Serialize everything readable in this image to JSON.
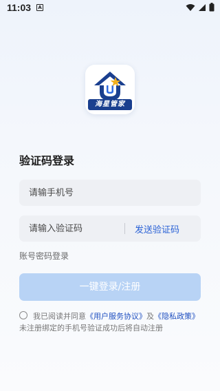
{
  "status_bar": {
    "time": "11:03",
    "notification_icon": "a-notification-icon",
    "right_icons": [
      "wifi-icon",
      "signal-icon",
      "battery-icon"
    ]
  },
  "app": {
    "logo_text": "海星管家"
  },
  "login": {
    "heading": "验证码登录",
    "phone_placeholder": "请输手机号",
    "code_placeholder": "请输入验证码",
    "send_code_label": "发送验证码",
    "password_login_label": "账号密码登录",
    "login_button_label": "一键登录/注册"
  },
  "agreement": {
    "prefix": "我已阅读并同意",
    "user_agreement": "《用户服务协议》",
    "and": "及",
    "privacy_policy": "《隐私政策》",
    "suffix": "未注册绑定的手机号验证成功后将自动注册"
  },
  "colors": {
    "accent": "#2b62d6",
    "button_disabled": "#b8d3f5",
    "logo_navy": "#1a3f8f",
    "logo_star": "#f2b01e"
  }
}
